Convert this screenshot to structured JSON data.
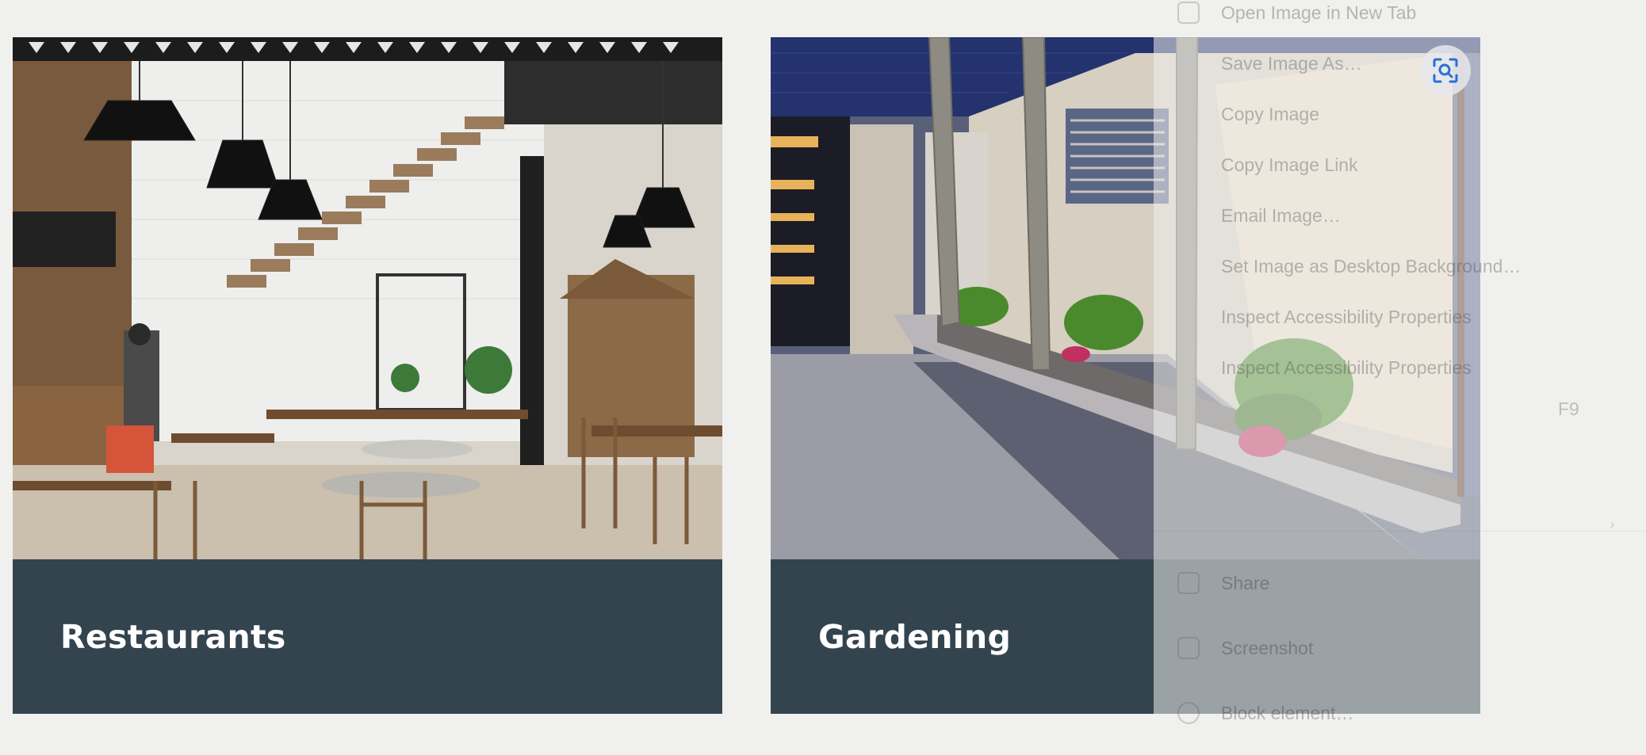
{
  "cards": [
    {
      "title": "Restaurants",
      "image": "restaurant-interior-photo"
    },
    {
      "title": "Gardening",
      "image": "garden-lighting-photo"
    }
  ],
  "context_menu": {
    "items": [
      {
        "label": "Open Image in New Tab",
        "icon": "new-tab-icon"
      },
      {
        "label": "Save Image As…"
      },
      {
        "label": "Copy Image"
      },
      {
        "label": "Copy Image Link"
      },
      {
        "label": "Email Image…"
      },
      {
        "label": "Set Image as Desktop Background…"
      },
      {
        "label": "Inspect Accessibility Properties"
      },
      {
        "label": "Share",
        "icon": "share-icon"
      },
      {
        "label": "Screenshot",
        "icon": "screenshot-icon"
      },
      {
        "label": "Block element…",
        "icon": "block-icon"
      }
    ],
    "shortcut": "F9"
  },
  "colors": {
    "caption_bg": "#34444f",
    "page_bg": "#f0f0ef",
    "lens_icon": "#2a6fd6"
  }
}
